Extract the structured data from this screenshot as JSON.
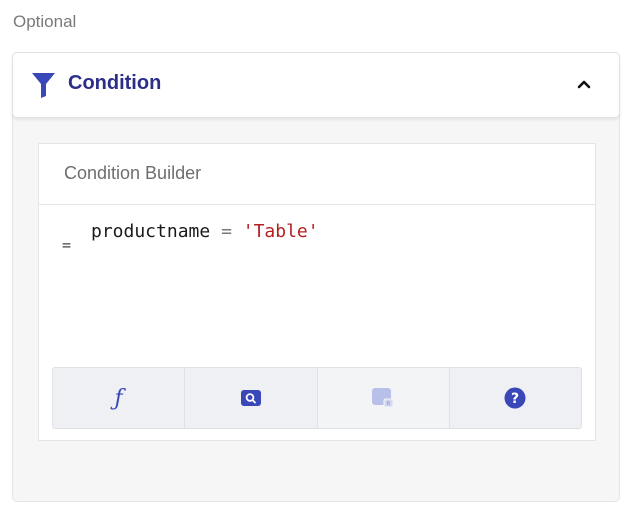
{
  "section": {
    "label": "Optional"
  },
  "panel": {
    "title": "Condition",
    "icon": "filter-icon",
    "toggle_icon": "chevron-up-icon",
    "expanded": true
  },
  "builder": {
    "title": "Condition Builder",
    "gutter_symbol": "=",
    "expression": {
      "field": "productname",
      "operator": "=",
      "value": "'Table'"
    },
    "toolbar": [
      {
        "name": "function-button",
        "icon": "function-icon",
        "symbol": "ƒ",
        "enabled": true
      },
      {
        "name": "search-button",
        "icon": "search-icon",
        "enabled": true
      },
      {
        "name": "insert-field-button",
        "icon": "field-icon",
        "enabled": false
      },
      {
        "name": "help-button",
        "icon": "help-icon",
        "symbol": "?",
        "enabled": true
      }
    ]
  },
  "colors": {
    "accent": "#3a47b8",
    "title": "#2b2f8a",
    "string_literal": "#b51f1f",
    "disabled_icon": "#b8bfe8"
  }
}
